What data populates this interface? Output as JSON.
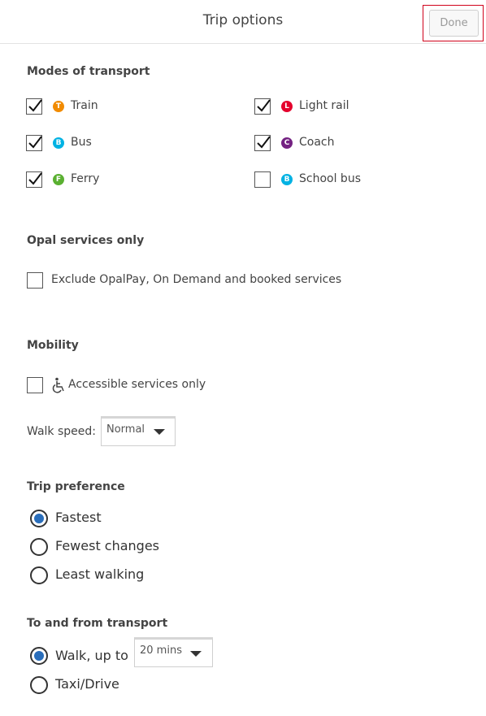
{
  "header": {
    "title": "Trip options",
    "done_label": "Done"
  },
  "modes": {
    "title": "Modes of transport",
    "items": [
      {
        "label": "Train",
        "badge": "T",
        "color": "#f18b00",
        "checked": true
      },
      {
        "label": "Light rail",
        "badge": "L",
        "color": "#e4022d",
        "checked": true
      },
      {
        "label": "Bus",
        "badge": "B",
        "color": "#00b2e3",
        "checked": true
      },
      {
        "label": "Coach",
        "badge": "C",
        "color": "#742282",
        "checked": true
      },
      {
        "label": "Ferry",
        "badge": "F",
        "color": "#5ab031",
        "checked": true
      },
      {
        "label": "School bus",
        "badge": "B",
        "color": "#00b2e3",
        "checked": false
      }
    ]
  },
  "opal": {
    "title": "Opal services only",
    "exclude_label": "Exclude OpalPay, On Demand and booked services",
    "checked": false
  },
  "mobility": {
    "title": "Mobility",
    "accessible_label": "Accessible services only",
    "accessible_checked": false,
    "walk_speed_label": "Walk speed:",
    "walk_speed_value": "Normal"
  },
  "trip_preference": {
    "title": "Trip preference",
    "options": [
      "Fastest",
      "Fewest changes",
      "Least walking"
    ],
    "selected": "Fastest"
  },
  "to_from": {
    "title": "To and from transport",
    "walk_label": "Walk, up to",
    "walk_value": "20 mins",
    "taxi_label": "Taxi/Drive",
    "selected": "walk"
  }
}
